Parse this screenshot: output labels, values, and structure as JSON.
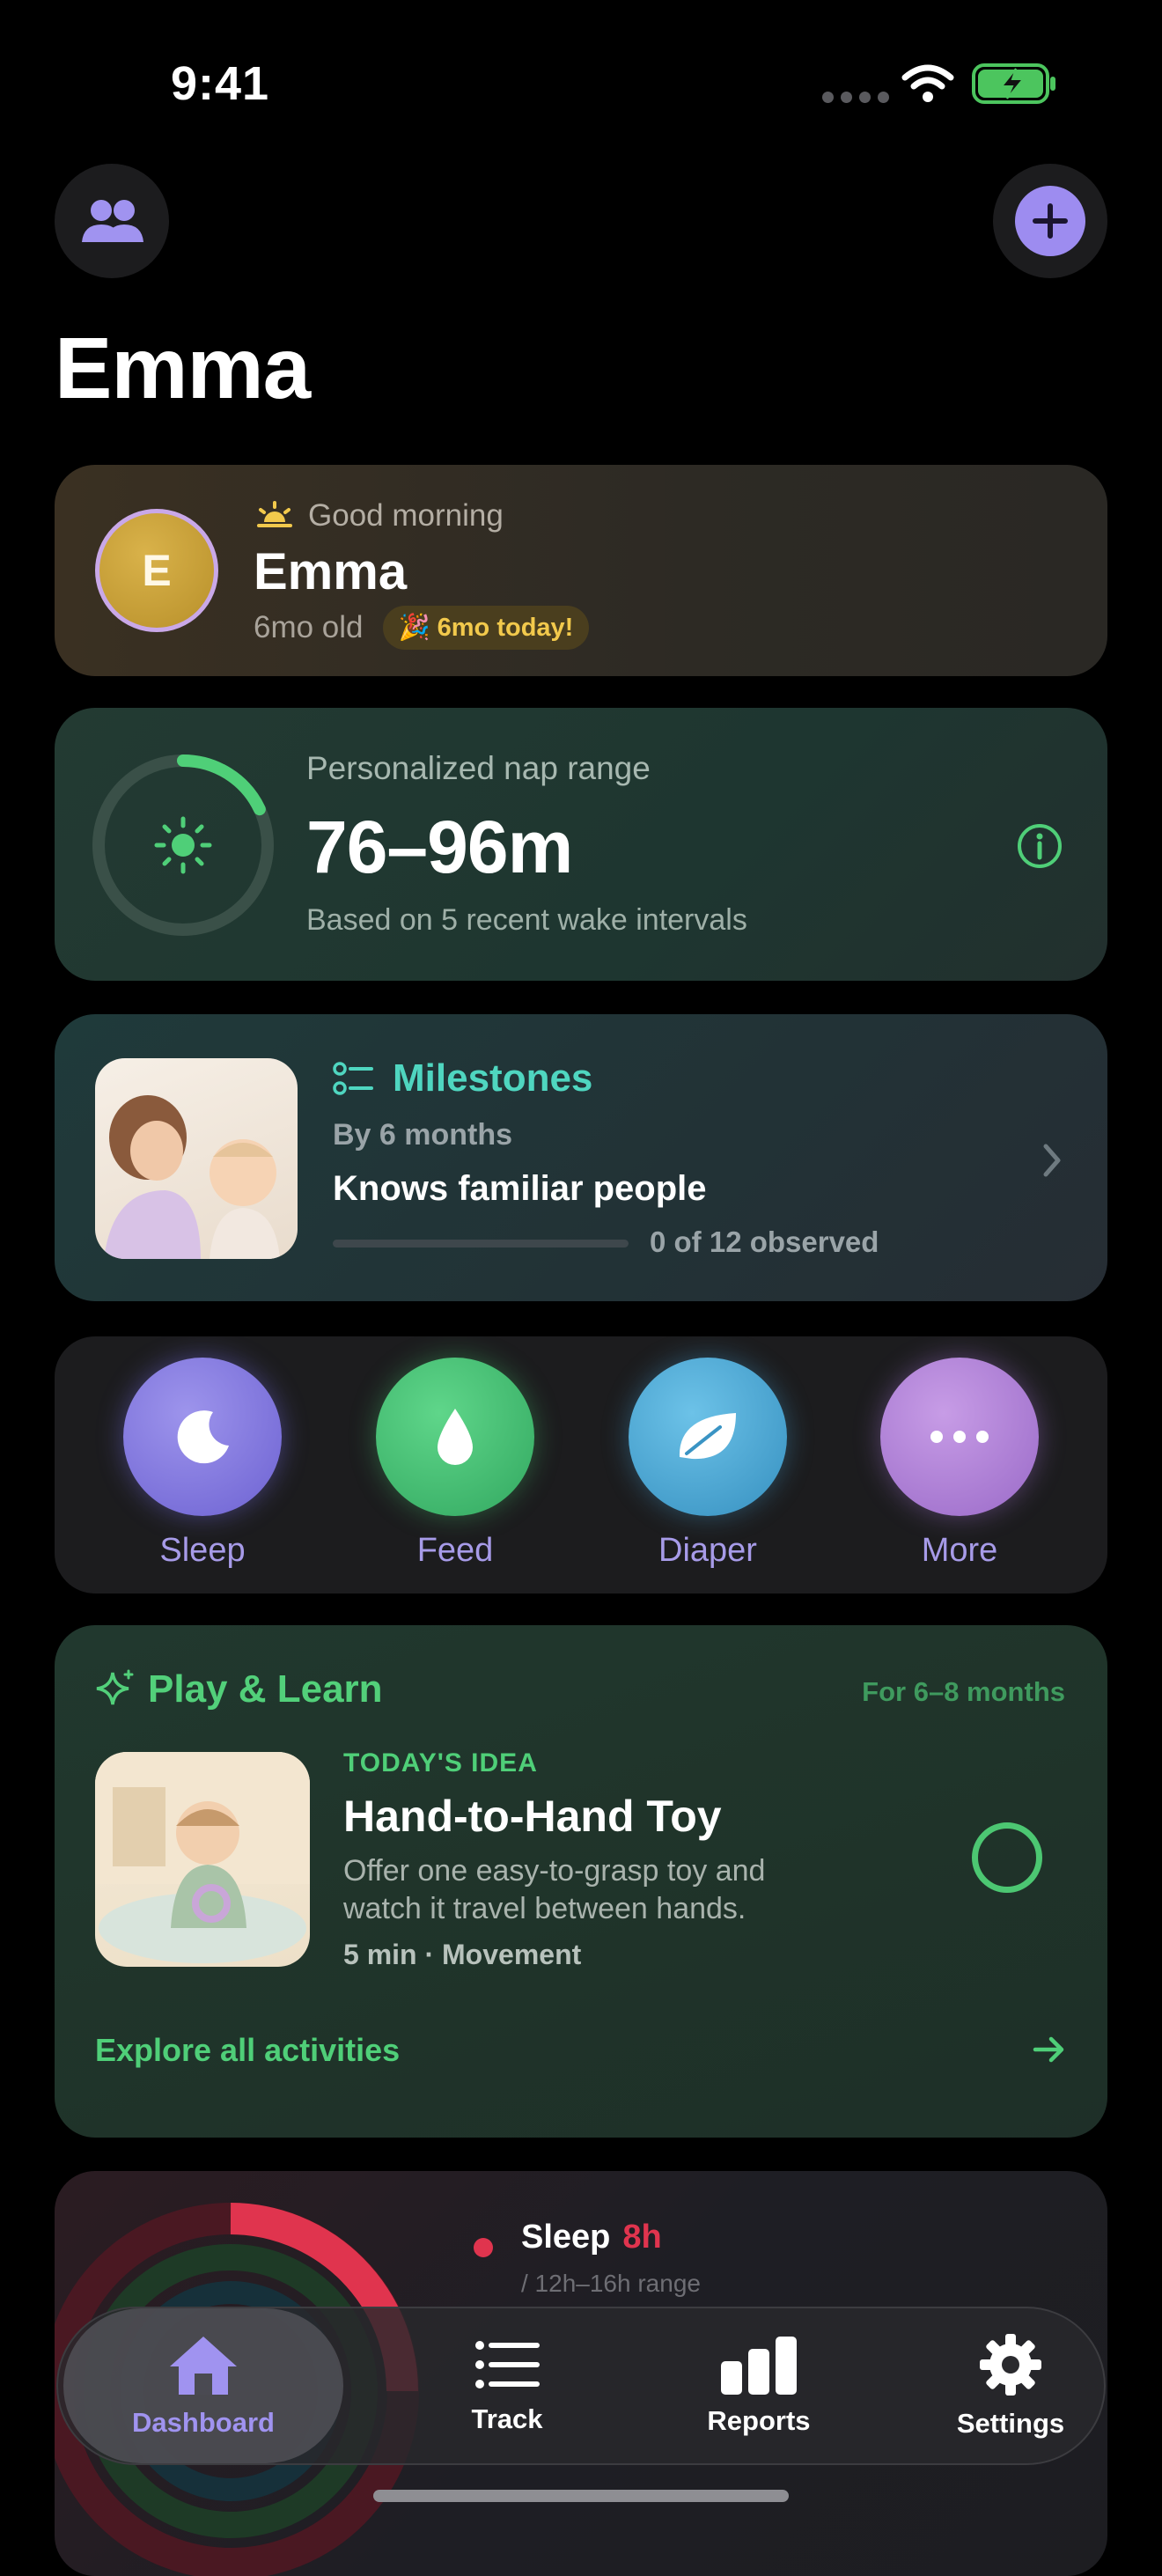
{
  "status_bar": {
    "time": "9:41"
  },
  "header": {
    "title": "Emma"
  },
  "greeting": {
    "salutation": "Good morning",
    "avatar_initial": "E",
    "name": "Emma",
    "age": "6mo old",
    "badge": "6mo today!"
  },
  "nap": {
    "label": "Personalized nap range",
    "value": "76–96m",
    "subtitle": "Based on 5 recent wake intervals",
    "ring_progress": 0.18
  },
  "milestones": {
    "title": "Milestones",
    "by": "By 6 months",
    "item": "Knows familiar people",
    "observed": "0 of 12 observed",
    "progress": 0
  },
  "quick_actions": [
    {
      "label": "Sleep",
      "icon": "moon-icon"
    },
    {
      "label": "Feed",
      "icon": "droplet-icon"
    },
    {
      "label": "Diaper",
      "icon": "leaf-icon"
    },
    {
      "label": "More",
      "icon": "ellipsis-icon"
    }
  ],
  "play": {
    "title": "Play & Learn",
    "range": "For 6–8 months",
    "tag": "TODAY'S IDEA",
    "name": "Hand-to-Hand Toy",
    "description": "Offer one easy-to-grasp toy and watch it travel between hands.",
    "meta": "5 min · Movement",
    "explore": "Explore all activities"
  },
  "summary": {
    "sleep_label": "Sleep",
    "sleep_value": "8h",
    "sleep_range": "/ 12h–16h range"
  },
  "tabs": [
    {
      "label": "Dashboard",
      "icon": "home-icon",
      "active": true
    },
    {
      "label": "Track",
      "icon": "list-icon",
      "active": false
    },
    {
      "label": "Reports",
      "icon": "bar-chart-icon",
      "active": false
    },
    {
      "label": "Settings",
      "icon": "gear-icon",
      "active": false
    }
  ],
  "colors": {
    "accent_purple": "#9d8cf0",
    "green": "#4fcf78",
    "teal": "#4fd6c0",
    "sleep_red": "#e0344e"
  }
}
